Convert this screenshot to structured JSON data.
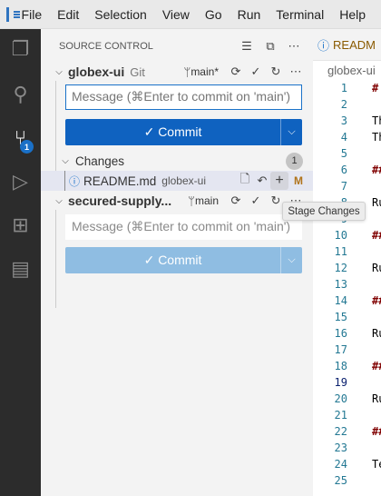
{
  "menu": [
    "File",
    "Edit",
    "Selection",
    "View",
    "Go",
    "Run",
    "Terminal",
    "Help"
  ],
  "activity": {
    "scm_badge": "1"
  },
  "sidebar": {
    "title": "SOURCE CONTROL",
    "repos": [
      {
        "name": "globex-ui",
        "type": "Git",
        "branch": "main*",
        "message_placeholder": "Message (⌘Enter to commit on 'main')",
        "commit_label": "✓ Commit",
        "changes_label": "Changes",
        "changes_count": "1",
        "files": [
          {
            "name": "README.md",
            "folder": "globex-ui",
            "status": "M"
          }
        ]
      },
      {
        "name": "secured-supply...",
        "branch": "main",
        "message_placeholder": "Message (⌘Enter to commit on 'main')",
        "commit_label": "✓ Commit"
      }
    ]
  },
  "tooltip": "Stage Changes",
  "editor": {
    "tab": "READM",
    "breadcrumb": "globex-ui",
    "lines": [
      "1",
      "2",
      "3",
      "4",
      "5",
      "6",
      "7",
      "8",
      "9",
      "10",
      "11",
      "12",
      "13",
      "14",
      "15",
      "16",
      "17",
      "18",
      "19",
      "20",
      "21",
      "22",
      "23",
      "24",
      "25"
    ],
    "code": {
      "1": "#",
      "3": "Th",
      "4": "Th",
      "6": "##",
      "8": "Ru",
      "10": "##",
      "12": "Ru",
      "14": "##",
      "16": "Ru",
      "18": "##",
      "20": "Ru",
      "22": "##",
      "24": "Te"
    }
  },
  "colors": {
    "accent": "#0f62c0",
    "modified": "#b0731a",
    "badge": "#1a70c7"
  }
}
